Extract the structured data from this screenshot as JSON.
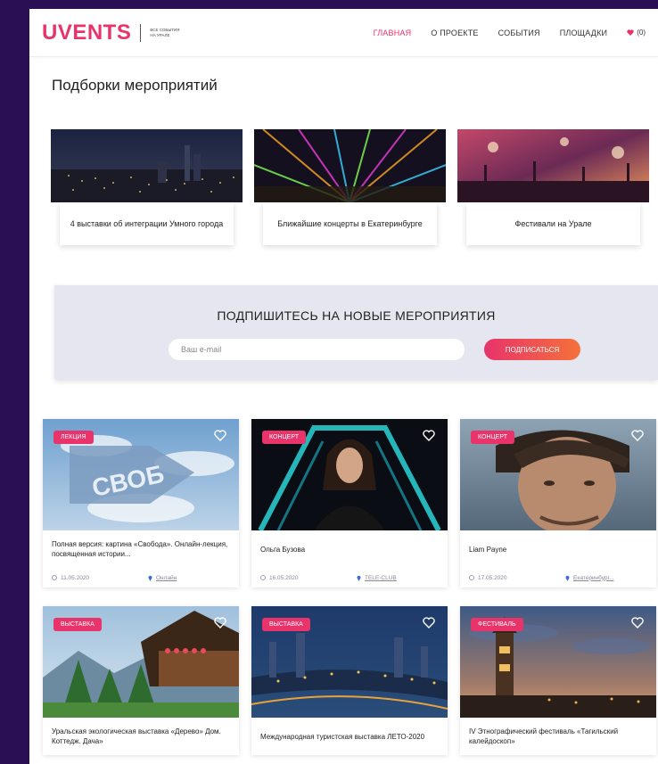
{
  "header": {
    "logo": "UVENTS",
    "tagline": "ВСЕ СОБЫТИЯ НА УРАЛЕ",
    "nav": [
      {
        "label": "ГЛАВНАЯ",
        "active": true
      },
      {
        "label": "О ПРОЕКТЕ",
        "active": false
      },
      {
        "label": "СОБЫТИЯ",
        "active": false
      },
      {
        "label": "ПЛОЩАДКИ",
        "active": false
      }
    ],
    "favorites_count": "(0)"
  },
  "collections_title": "Подборки мероприятий",
  "collections": [
    {
      "caption": "4 выставки об интеграции Умного города",
      "image": "city-night-photo"
    },
    {
      "caption": "Ближайшие концерты в Екатеринбурге",
      "image": "concert-lights-photo"
    },
    {
      "caption": "Фестивали на Урале",
      "image": "festival-crowd-photo"
    }
  ],
  "subscribe": {
    "title": "ПОДПИШИТЕСЬ НА НОВЫЕ МЕРОПРИЯТИЯ",
    "placeholder": "Ваш e-mail",
    "button": "ПОДПИСАТЬСЯ"
  },
  "events": [
    {
      "badge": "ЛЕКЦИЯ",
      "title": "Полная версия: картина «Свобода». Онлайн-лекция, посвященная истории...",
      "date": "11.05.2020",
      "place": "Онлайн"
    },
    {
      "badge": "КОНЦЕРТ",
      "title": "Ольга Бузова",
      "date": "16.05.2020",
      "place": "TELE-CLUB"
    },
    {
      "badge": "КОНЦЕРТ",
      "title": "Liam Payne",
      "date": "17.05.2020",
      "place": "Екатеринбург..."
    },
    {
      "badge": "ВЫСТАВКА",
      "title": "Уральская экологическая выставка «Дерево» Дом. Коттедж. Дача»",
      "date": "",
      "place": ""
    },
    {
      "badge": "ВЫСТАВКА",
      "title": "Международная туристская выставка ЛЕТО-2020",
      "date": "",
      "place": ""
    },
    {
      "badge": "ФЕСТИВАЛЬ",
      "title": "IV Этнографический фестиваль «Тагильский калейдоскоп»",
      "date": "",
      "place": ""
    }
  ],
  "colors": {
    "accent": "#e8336b",
    "accent2": "#f5713a",
    "frame": "#2a0f55",
    "subscribe_bg": "#e6e6f0"
  }
}
